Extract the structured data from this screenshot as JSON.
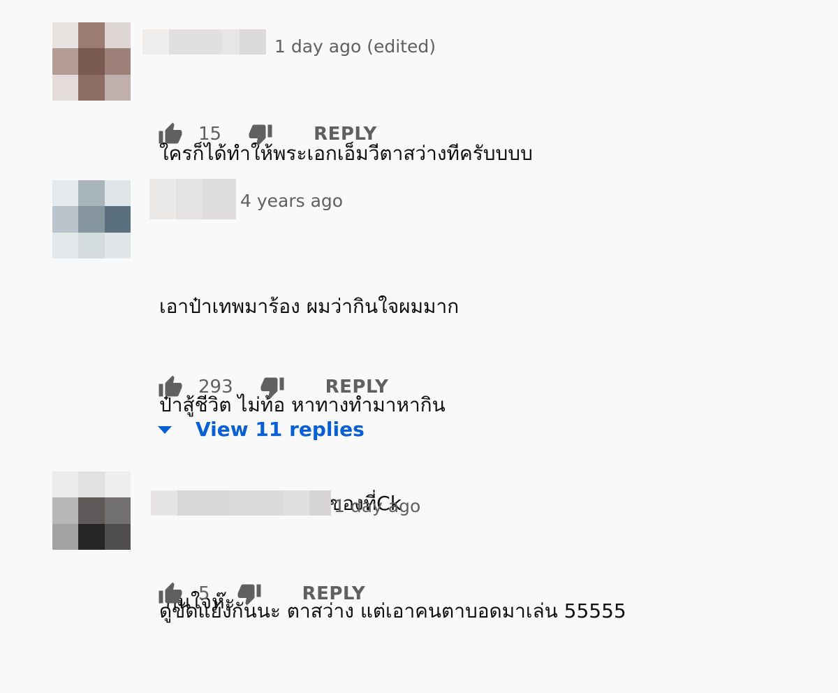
{
  "comments": [
    {
      "timestamp": "1 day ago (edited)",
      "lines": [
        "ใครก็ได้ทำให้พระเอกเอ็มวีตาสว่างทีครับบบบ"
      ],
      "likes": "15",
      "reply_label": "REPLY"
    },
    {
      "timestamp": "4 years ago",
      "lines": [
        "เอาป๋าเทพมาร้อง ผมว่ากินใจผมมาก",
        "ป๋าสู้ชีวิต ไม่ท้อ หาทางทำมาหากิน",
        "ผมเจอป๋าเทพมาขายของที่Ck",
        " กินใจห๊ะ"
      ],
      "likes": "293",
      "reply_label": "REPLY",
      "view_replies": "View 11 replies"
    },
    {
      "timestamp": "1 day ago",
      "lines": [
        "ดูขัดแย้งกันนะ ตาสว่าง แต่เอาคนตาบอดมาเล่น 55555"
      ],
      "likes": "5",
      "reply_label": "REPLY"
    }
  ],
  "colors": {
    "background": "#f9f9f9",
    "link": "#065fd4",
    "secondary_text": "#606060"
  },
  "icons": {
    "like": "thumbs-up-icon",
    "dislike": "thumbs-down-icon",
    "expand": "caret-down-icon"
  }
}
